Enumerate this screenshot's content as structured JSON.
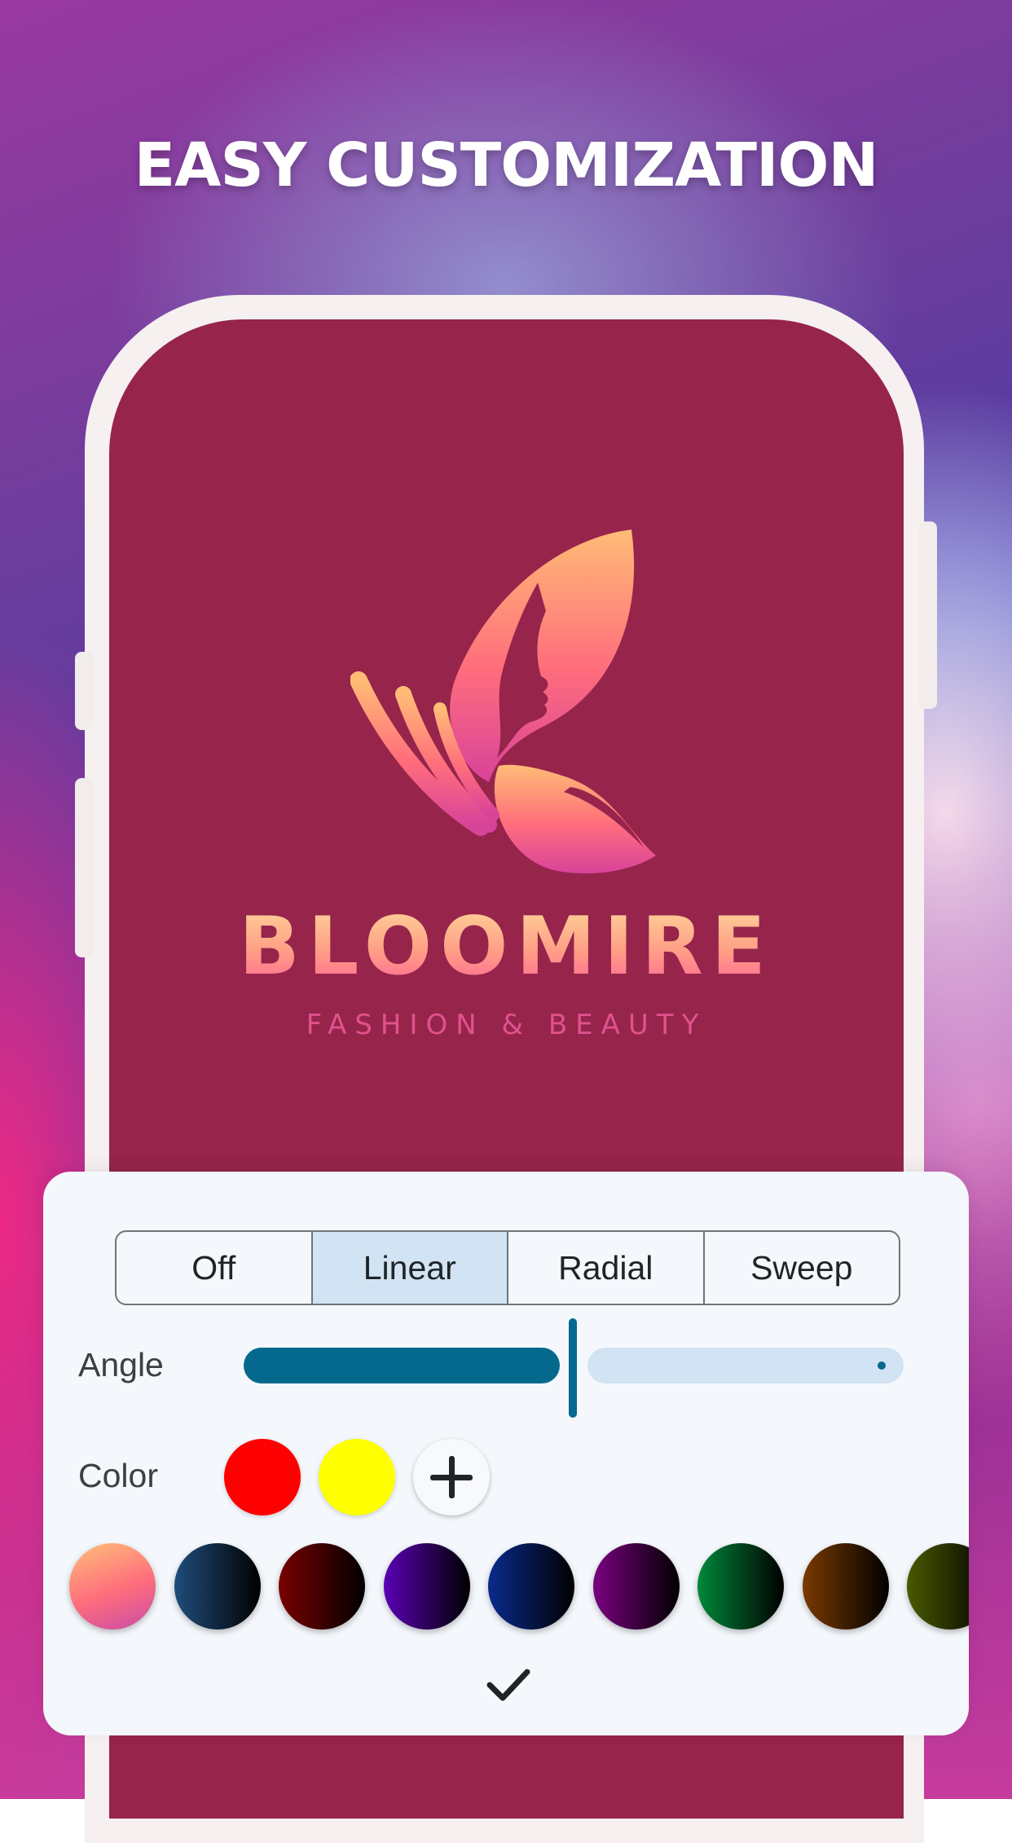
{
  "headline": "EASY CUSTOMIZATION",
  "brand": {
    "name": "BLOOMIRE",
    "tagline": "FASHION & BEAUTY"
  },
  "gradient_panel": {
    "modes": [
      {
        "label": "Off",
        "selected": false
      },
      {
        "label": "Linear",
        "selected": true
      },
      {
        "label": "Radial",
        "selected": false
      },
      {
        "label": "Sweep",
        "selected": false
      }
    ],
    "angle_label": "Angle",
    "angle_value_fraction": 0.5,
    "color_label": "Color",
    "selected_colors": [
      "#ff0000",
      "#ffff00"
    ],
    "presets": [
      {
        "from": "#ffc07a",
        "to": "#c84ba8"
      },
      {
        "from": "#1e4d7a",
        "to": "#000000"
      },
      {
        "from": "#7a0000",
        "to": "#000000"
      },
      {
        "from": "#5a00b4",
        "to": "#000000"
      },
      {
        "from": "#0a2a8c",
        "to": "#000000"
      },
      {
        "from": "#7a0080",
        "to": "#000000"
      },
      {
        "from": "#00883a",
        "to": "#000000"
      },
      {
        "from": "#7a3a00",
        "to": "#000000"
      },
      {
        "from": "#4a5a00",
        "to": "#000000"
      }
    ]
  },
  "colors": {
    "screen_background": "#96244b",
    "accent": "#05698e",
    "segment_selected": "#d2e3f3"
  }
}
